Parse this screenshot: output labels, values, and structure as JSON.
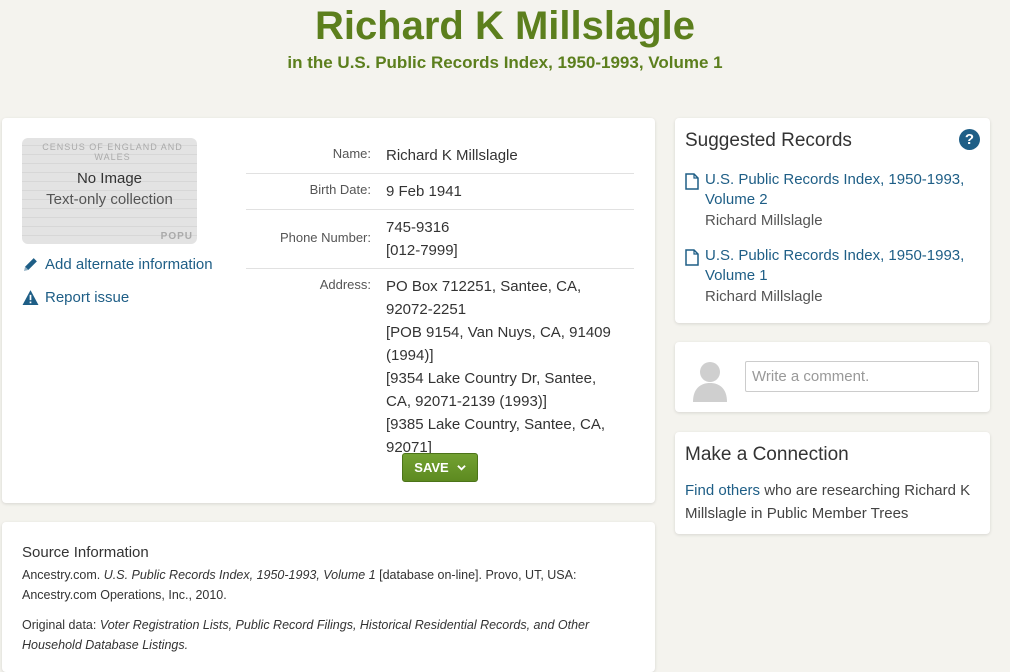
{
  "header": {
    "title": "Richard K Millslagle",
    "subtitle": "in the U.S. Public Records Index, 1950-1993, Volume 1"
  },
  "thumbnail": {
    "no_image": "No Image",
    "text_only": "Text-only collection",
    "doc_text": "CENSUS OF ENGLAND AND WALES",
    "doc_text2": "POPU"
  },
  "actions": {
    "add_alternate": "Add alternate information",
    "report_issue": "Report issue"
  },
  "facts": {
    "name_label": "Name:",
    "name": "Richard K Millslagle",
    "birth_label": "Birth Date:",
    "birth": "9 Feb 1941",
    "phone_label": "Phone Number:",
    "phones": [
      "745-9316",
      "[012-7999]"
    ],
    "address_label": "Address:",
    "addresses": [
      "PO Box 712251, Santee, CA,",
      "92072-2251",
      "[POB 9154, Van Nuys, CA, 91409",
      "(1994)]",
      "[9354 Lake Country Dr, Santee,",
      "CA, 92071-2139 (1993)]",
      "[9385 Lake Country, Santee, CA,",
      "92071]"
    ]
  },
  "save_label": "SAVE",
  "source": {
    "heading": "Source Information",
    "line1_pre": "Ancestry.com. ",
    "line1_italic": "U.S. Public Records Index, 1950-1993, Volume 1",
    "line1_post": " [database on-line]. Provo, UT, USA:",
    "line2": "Ancestry.com Operations, Inc., 2010.",
    "orig_pre": "Original data: ",
    "orig_italic_1": "Voter Registration Lists, Public Record Filings, Historical Residential Records, and Other",
    "orig_italic_2": "Household Database Listings."
  },
  "suggested": {
    "title": "Suggested Records",
    "help": "?",
    "items": [
      {
        "line1": "U.S. Public Records Index, 1950-1993,",
        "line2": "Volume 2",
        "person": "Richard Millslagle"
      },
      {
        "line1": "U.S. Public Records Index, 1950-1993,",
        "line2": "Volume 1",
        "person": "Richard Millslagle"
      }
    ]
  },
  "comment": {
    "placeholder": "Write a comment."
  },
  "connection": {
    "title": "Make a Connection",
    "link": "Find others",
    "text_1": " who are researching Richard K",
    "text_2": "Millslagle in Public Member Trees"
  },
  "colors": {
    "title_green": "#5c7f1d",
    "link_blue": "#1e5e86",
    "save_green": "#6a9a2b"
  }
}
